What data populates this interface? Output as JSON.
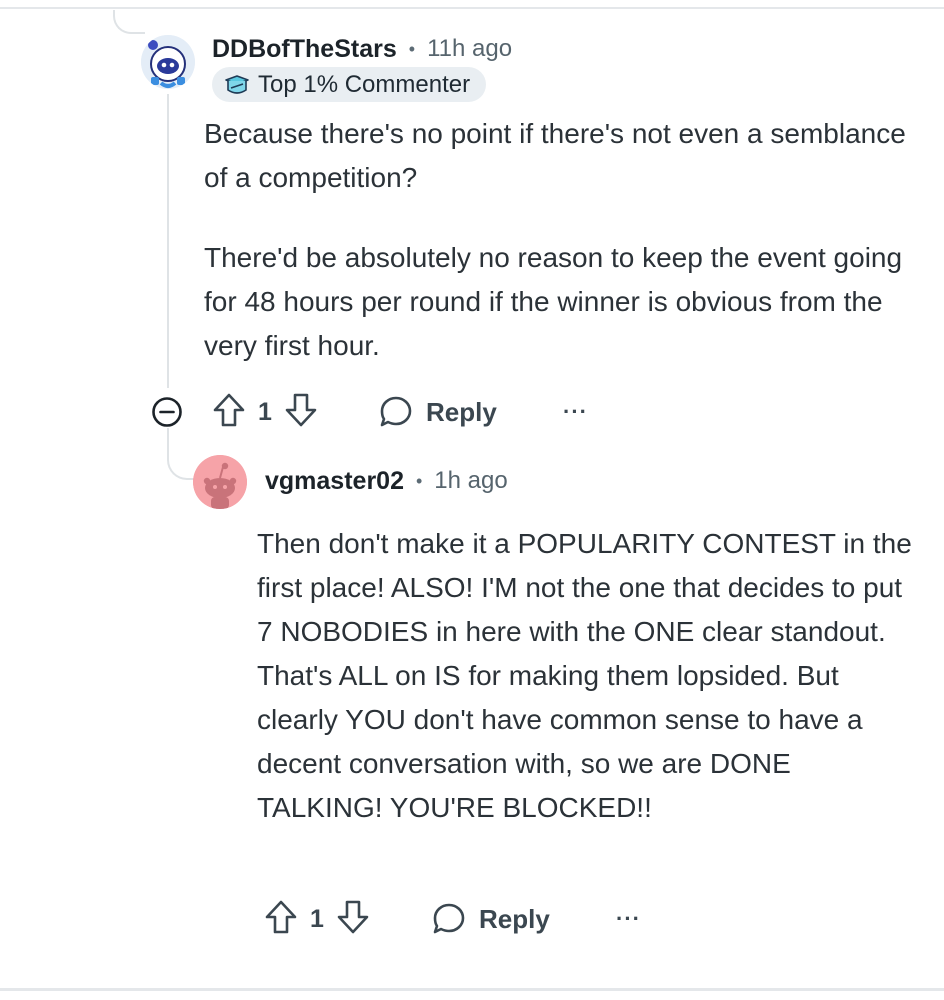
{
  "comments": [
    {
      "username": "DDBofTheStars",
      "time": "11h ago",
      "badge": "Top 1% Commenter",
      "paragraphs": [
        "Because there's no point if there's not even a semblance of a competition?",
        "There'd be absolutely no reason to keep the event going for 48 hours per round if the winner is obvious from the very first hour."
      ],
      "votes": "1",
      "reply_label": "Reply",
      "more_label": "···"
    },
    {
      "username": "vgmaster02",
      "time": "1h ago",
      "paragraphs": [
        "Then don't make it a POPULARITY CONTEST in the first place! ALSO! I'M not the one that decides to put 7 NOBODIES in here with the ONE clear standout. That's ALL on IS for making them lopsided. But clearly YOU don't have common sense to have a decent conversation with, so we are DONE TALKING! YOU'RE BLOCKED!!"
      ],
      "votes": "1",
      "reply_label": "Reply",
      "more_label": "···"
    }
  ],
  "separator": "•",
  "icons": {
    "collapse": "collapse-minus-icon",
    "upvote": "upvote-arrow-icon",
    "downvote": "downvote-arrow-icon",
    "reply": "speech-bubble-icon",
    "badge": "commenter-badge-icon"
  },
  "colors": {
    "text": "#2b3238",
    "username": "#1c2329",
    "meta": "#56646d",
    "badge_bg": "#e9eef2",
    "thread_line": "#dfe3e6",
    "avatar2_bg": "#f6a3a8"
  }
}
